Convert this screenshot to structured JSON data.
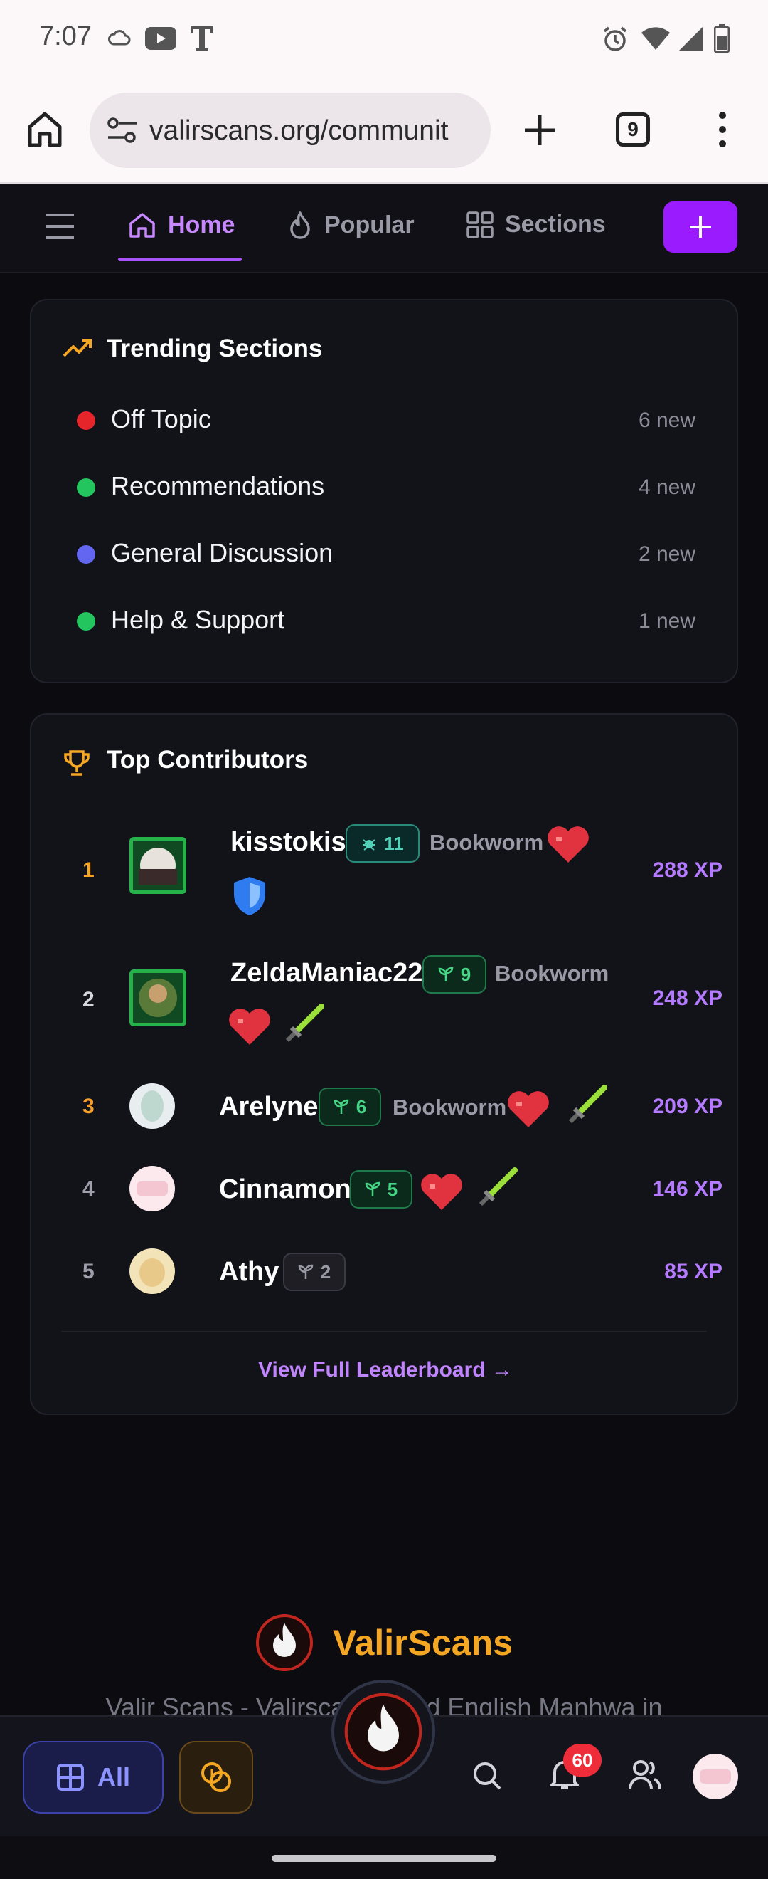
{
  "status_bar": {
    "time": "7:07",
    "icons": [
      "cloud-icon",
      "youtube-icon",
      "tmobile-icon",
      "alarm-icon",
      "wifi-icon",
      "signal-icon",
      "battery-icon"
    ]
  },
  "browser": {
    "url": "valirscans.org/communit",
    "tab_count": "9"
  },
  "nav": {
    "home": "Home",
    "popular": "Popular",
    "sections": "Sections",
    "new_post_icon": "plus-icon"
  },
  "trending": {
    "title": "Trending Sections",
    "items": [
      {
        "label": "Off Topic",
        "count": "6 new",
        "color": "#e5252a"
      },
      {
        "label": "Recommendations",
        "count": "4 new",
        "color": "#22c55e"
      },
      {
        "label": "General Discussion",
        "count": "2 new",
        "color": "#6366f1"
      },
      {
        "label": "Help & Support",
        "count": "1 new",
        "color": "#22c55e"
      }
    ]
  },
  "contributors": {
    "title": "Top Contributors",
    "users": [
      {
        "rank": "1",
        "name": "kisstokis",
        "level": "11",
        "badge": "Bookworm",
        "xp": "288 XP"
      },
      {
        "rank": "2",
        "name": "ZeldaManiac22",
        "level": "9",
        "badge": "Bookworm",
        "xp": "248 XP"
      },
      {
        "rank": "3",
        "name": "Arelyne",
        "level": "6",
        "badge": "Bookworm",
        "xp": "209 XP"
      },
      {
        "rank": "4",
        "name": "Cinnamon",
        "level": "5",
        "badge": "",
        "xp": "146 XP"
      },
      {
        "rank": "5",
        "name": "Athy",
        "level": "2",
        "badge": "",
        "xp": "85 XP"
      }
    ],
    "leaderboard_link": "View Full Leaderboard →"
  },
  "footer": {
    "brand": "ValirScans",
    "tagline": "Valir Scans - Valirscans Read English Manhwa in"
  },
  "bottom_bar": {
    "all_label": "All",
    "notification_count": "60"
  },
  "colors": {
    "accent_purple": "#a855f7",
    "xp_purple": "#b57bff",
    "rank_gold": "#f5a623",
    "brand_orange": "#f5a623"
  }
}
